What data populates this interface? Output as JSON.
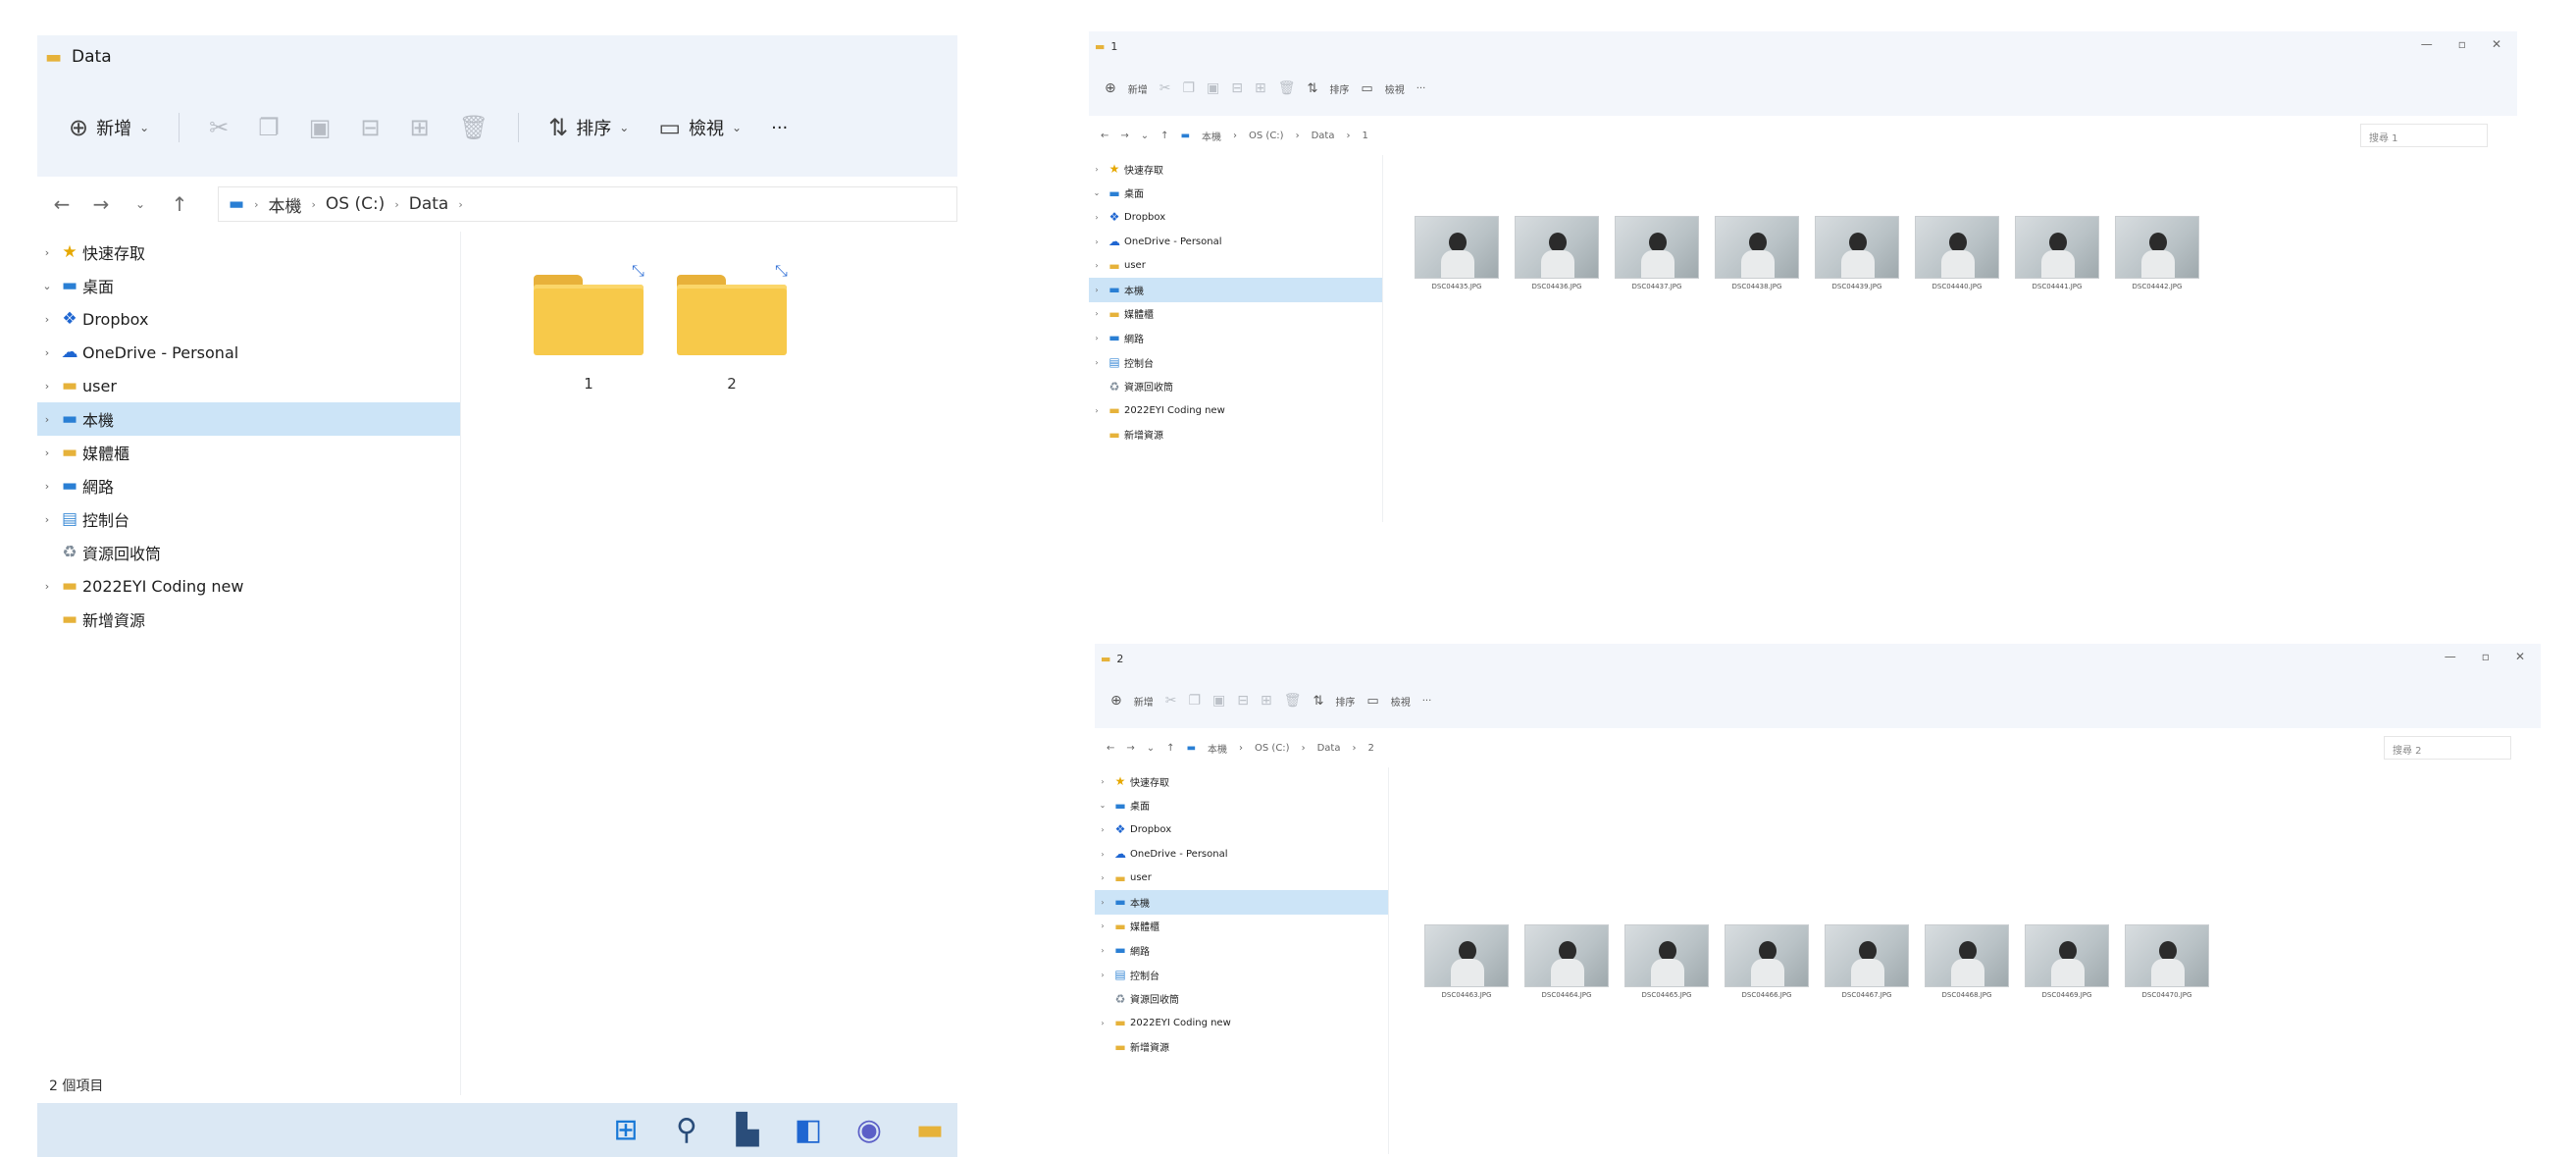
{
  "main": {
    "title": "Data",
    "cmd": {
      "new_label": "新增",
      "sort_label": "排序",
      "view_label": "檢視",
      "more_label": "···"
    },
    "breadcrumb": [
      "本機",
      "OS (C:)",
      "Data"
    ],
    "nav_items": [
      {
        "label": "快速存取",
        "chev": "›",
        "icon": "★",
        "color": "#e6a800"
      },
      {
        "label": "桌面",
        "chev": "⌄",
        "icon": "▬",
        "color": "#2a7fd4"
      },
      {
        "label": "Dropbox",
        "chev": "›",
        "icon": "❖",
        "color": "#1f66d1"
      },
      {
        "label": "OneDrive - Personal",
        "chev": "›",
        "icon": "☁",
        "color": "#1f66d1"
      },
      {
        "label": "user",
        "chev": "›",
        "icon": "▬",
        "color": "#e6b23a"
      },
      {
        "label": "本機",
        "chev": "›",
        "icon": "▬",
        "color": "#2a7fd4",
        "selected": true
      },
      {
        "label": "媒體櫃",
        "chev": "›",
        "icon": "▬",
        "color": "#e6b23a"
      },
      {
        "label": "網路",
        "chev": "›",
        "icon": "▬",
        "color": "#2a7fd4"
      },
      {
        "label": "控制台",
        "chev": "›",
        "icon": "▤",
        "color": "#3a8ad6"
      },
      {
        "label": "資源回收筒",
        "chev": "",
        "icon": "♻",
        "color": "#7f8c99"
      },
      {
        "label": "2022EYI Coding new",
        "chev": "›",
        "icon": "▬",
        "color": "#e6b23a"
      },
      {
        "label": "新增資源",
        "chev": "",
        "icon": "▬",
        "color": "#e6b23a"
      }
    ],
    "folders": [
      {
        "label": "1"
      },
      {
        "label": "2"
      }
    ],
    "status": "2 個項目"
  },
  "taskbar": {
    "icons": [
      "windows-start-icon",
      "search-icon",
      "task-view-icon",
      "widgets-icon",
      "chat-icon",
      "file-explorer-icon"
    ]
  },
  "win1": {
    "title": "1",
    "cmd": {
      "new_label": "新增",
      "sort_label": "排序",
      "view_label": "檢視",
      "more_label": "···"
    },
    "breadcrumb": [
      "本機",
      "OS (C:)",
      "Data",
      "1"
    ],
    "search_placeholder": "搜尋 1",
    "files": [
      "DSC04435.JPG",
      "DSC04436.JPG",
      "DSC04437.JPG",
      "DSC04438.JPG",
      "DSC04439.JPG",
      "DSC04440.JPG",
      "DSC04441.JPG",
      "DSC04442.JPG"
    ]
  },
  "win2": {
    "title": "2",
    "cmd": {
      "new_label": "新增",
      "sort_label": "排序",
      "view_label": "檢視",
      "more_label": "···"
    },
    "breadcrumb": [
      "本機",
      "OS (C:)",
      "Data",
      "2"
    ],
    "search_placeholder": "搜尋 2",
    "files": [
      "DSC04463.JPG",
      "DSC04464.JPG",
      "DSC04465.JPG",
      "DSC04466.JPG",
      "DSC04467.JPG",
      "DSC04468.JPG",
      "DSC04469.JPG",
      "DSC04470.JPG"
    ]
  }
}
